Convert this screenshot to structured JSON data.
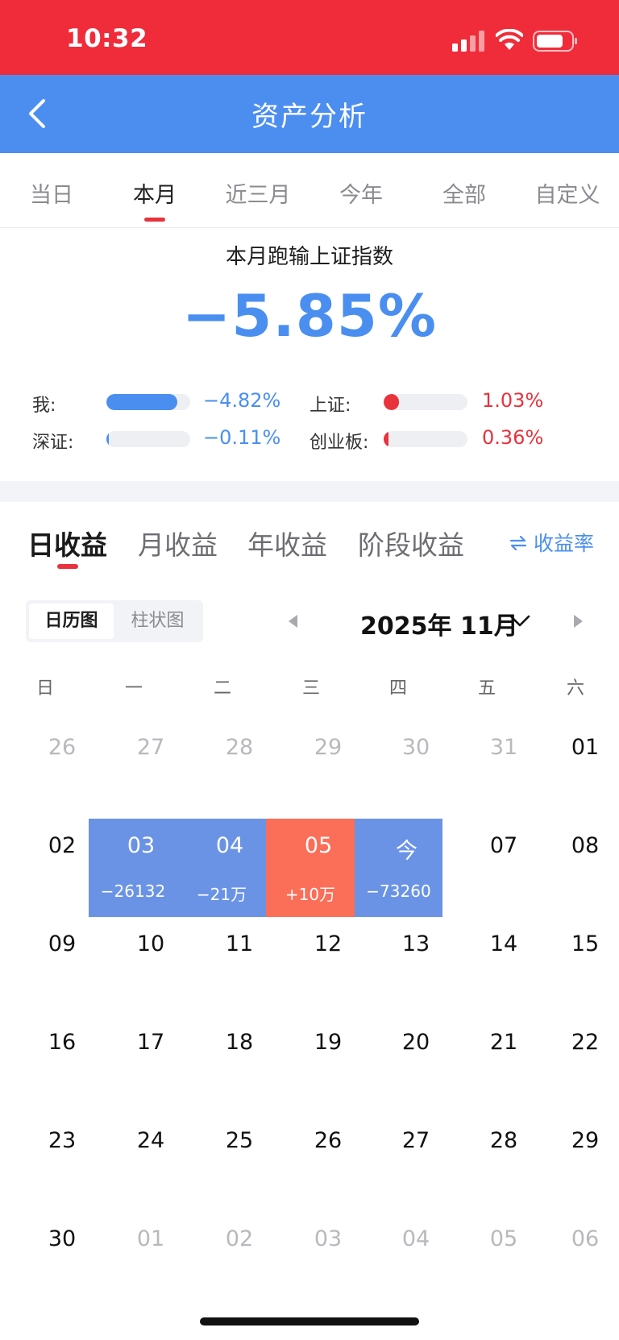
{
  "status": {
    "time": "10:32"
  },
  "header": {
    "title": "资产分析"
  },
  "periods": [
    {
      "label": "当日",
      "active": false
    },
    {
      "label": "本月",
      "active": true
    },
    {
      "label": "近三月",
      "active": false
    },
    {
      "label": "今年",
      "active": false
    },
    {
      "label": "全部",
      "active": false
    },
    {
      "label": "自定义",
      "active": false
    }
  ],
  "performance": {
    "subtitle": "本月跑输上证指数",
    "value": "−5.85%",
    "comparisons": [
      {
        "label": "我:",
        "value": "−4.82%",
        "fill": 0.85,
        "color": "#4a8ff0"
      },
      {
        "label": "上证:",
        "value": "1.03%",
        "fill": 0.18,
        "color": "#e8323c"
      },
      {
        "label": "深证:",
        "value": "−0.11%",
        "fill": 0.02,
        "color": "#4a8ff0"
      },
      {
        "label": "创业板:",
        "value": "0.36%",
        "fill": 0.06,
        "color": "#e8323c"
      }
    ]
  },
  "earnings_tabs": [
    {
      "label": "日收益",
      "active": true
    },
    {
      "label": "月收益",
      "active": false
    },
    {
      "label": "年收益",
      "active": false
    },
    {
      "label": "阶段收益",
      "active": false
    }
  ],
  "rate_toggle": {
    "icon": "swap-icon",
    "label": "收益率"
  },
  "view_toggle": {
    "selected": "日历图",
    "other": "柱状图"
  },
  "calendar": {
    "month_label": "2025年 11月",
    "weekdays": [
      "日",
      "一",
      "二",
      "三",
      "四",
      "五",
      "六"
    ],
    "weeks": [
      [
        {
          "d": "26",
          "dim": true
        },
        {
          "d": "27",
          "dim": true
        },
        {
          "d": "28",
          "dim": true
        },
        {
          "d": "29",
          "dim": true
        },
        {
          "d": "30",
          "dim": true
        },
        {
          "d": "31",
          "dim": true
        },
        {
          "d": "01"
        }
      ],
      [
        {
          "d": "02"
        },
        {
          "d": "03",
          "pl": "−26132",
          "color": "#6a93e6"
        },
        {
          "d": "04",
          "pl": "−21万",
          "color": "#6a93e6"
        },
        {
          "d": "05",
          "pl": "+10万",
          "color": "#fb6e58"
        },
        {
          "d": "今",
          "pl": "−73260",
          "color": "#6a93e6"
        },
        {
          "d": "07"
        },
        {
          "d": "08"
        }
      ],
      [
        {
          "d": "09"
        },
        {
          "d": "10"
        },
        {
          "d": "11"
        },
        {
          "d": "12"
        },
        {
          "d": "13"
        },
        {
          "d": "14"
        },
        {
          "d": "15"
        }
      ],
      [
        {
          "d": "16"
        },
        {
          "d": "17"
        },
        {
          "d": "18"
        },
        {
          "d": "19"
        },
        {
          "d": "20"
        },
        {
          "d": "21"
        },
        {
          "d": "22"
        }
      ],
      [
        {
          "d": "23"
        },
        {
          "d": "24"
        },
        {
          "d": "25"
        },
        {
          "d": "26"
        },
        {
          "d": "27"
        },
        {
          "d": "28"
        },
        {
          "d": "29"
        }
      ],
      [
        {
          "d": "30"
        },
        {
          "d": "01",
          "dim": true
        },
        {
          "d": "02",
          "dim": true
        },
        {
          "d": "03",
          "dim": true
        },
        {
          "d": "04",
          "dim": true
        },
        {
          "d": "05",
          "dim": true
        },
        {
          "d": "06",
          "dim": true
        }
      ]
    ]
  },
  "colors": {
    "status_bar": "#f02c3a",
    "header": "#4c8ef0",
    "accent_red": "#e8323c",
    "accent_blue": "#4a8ff0"
  }
}
